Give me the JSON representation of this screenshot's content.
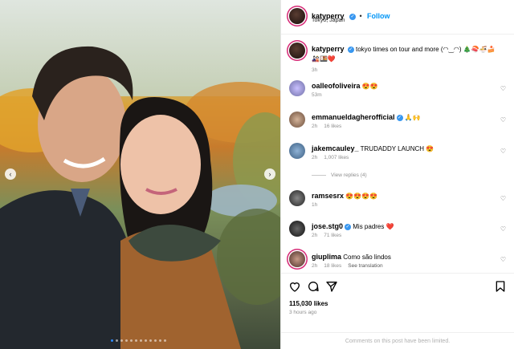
{
  "post": {
    "username": "katyperry",
    "follow_label": "Follow",
    "location": "Tokyo, Japan",
    "caption": "tokyo times on tour and more (◠‿◠) 🎄🍣🍜🍰🎎🍱❤️",
    "caption_time": "3h",
    "likes": "115,030 likes",
    "posted_ago": "3 hours ago",
    "comments_limited": "Comments on this post have been limited."
  },
  "comments": [
    {
      "username": "oalleofoliveira",
      "text": "😍😍",
      "time": "53m",
      "likes": "",
      "reply": ""
    },
    {
      "username": "emmanueldagherofficial",
      "text": "🙏🙌",
      "time": "2h",
      "likes": "16 likes",
      "reply": ""
    },
    {
      "username": "jakemcauley_",
      "text": "TRUDADDY LAUNCH 😍",
      "time": "2h",
      "likes": "1,007 likes",
      "reply": ""
    },
    {
      "username": "ramsesrx",
      "text": "😍😍😍😍",
      "time": "1h",
      "likes": "",
      "reply": ""
    },
    {
      "username": "jose.stg0",
      "text": "Mis padres ❤️",
      "time": "2h",
      "likes": "71 likes",
      "reply": ""
    },
    {
      "username": "giuplima",
      "text": "Como são lindos",
      "time": "2h",
      "likes": "18 likes",
      "reply": "See translation"
    }
  ],
  "view_replies": "View replies (4)",
  "carousel": {
    "total_slides": 12,
    "active_slide": 1
  },
  "colors": {
    "accent": "#0095f6",
    "verified": "#3897f0",
    "muted": "#8e8e8e"
  },
  "icons": {
    "like": "heart-icon",
    "comment": "comment-icon",
    "share": "paper-plane-icon",
    "save": "bookmark-icon",
    "prev": "chevron-left-icon",
    "next": "chevron-right-icon"
  }
}
